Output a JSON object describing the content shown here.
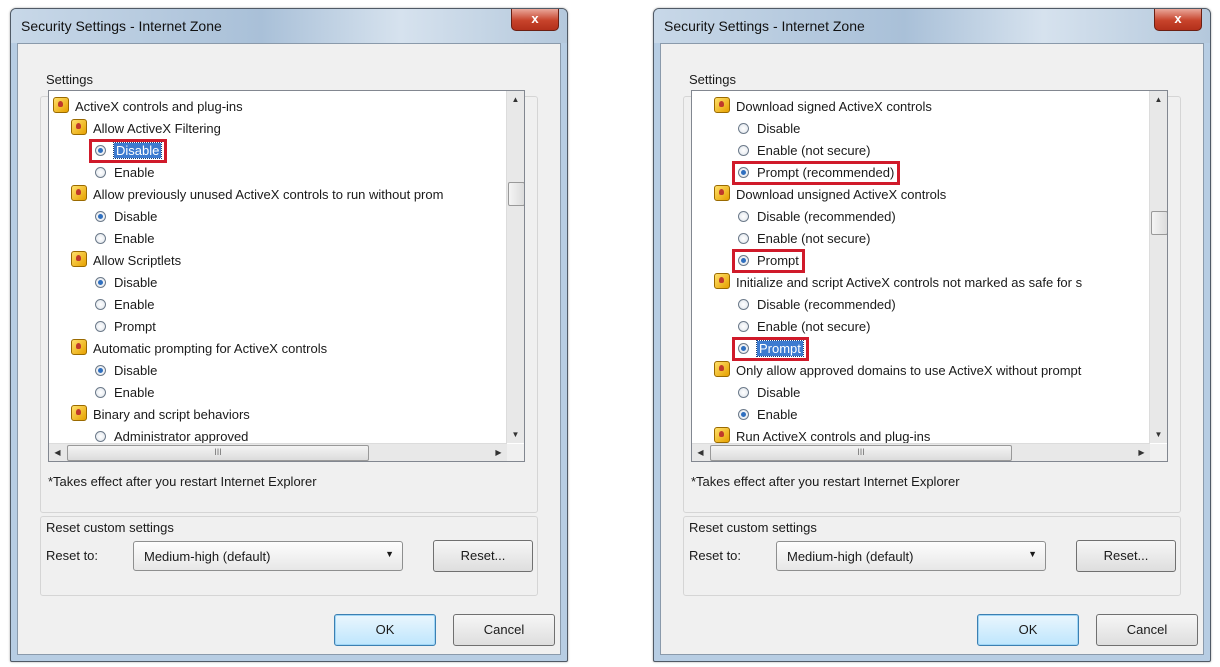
{
  "dialogs": [
    {
      "title": "Security Settings - Internet Zone",
      "close_label": "x",
      "settings_label": "Settings",
      "list_items": [
        {
          "kind": "category",
          "text": "ActiveX controls and plug-ins"
        },
        {
          "kind": "setting",
          "text": "Allow ActiveX Filtering"
        },
        {
          "kind": "option",
          "text": "Disable",
          "checked": true,
          "selected": true,
          "boxed": true
        },
        {
          "kind": "option",
          "text": "Enable",
          "checked": false
        },
        {
          "kind": "setting",
          "text": "Allow previously unused ActiveX controls to run without prom"
        },
        {
          "kind": "option",
          "text": "Disable",
          "checked": true
        },
        {
          "kind": "option",
          "text": "Enable",
          "checked": false
        },
        {
          "kind": "setting",
          "text": "Allow Scriptlets"
        },
        {
          "kind": "option",
          "text": "Disable",
          "checked": true
        },
        {
          "kind": "option",
          "text": "Enable",
          "checked": false
        },
        {
          "kind": "option",
          "text": "Prompt",
          "checked": false
        },
        {
          "kind": "setting",
          "text": "Automatic prompting for ActiveX controls"
        },
        {
          "kind": "option",
          "text": "Disable",
          "checked": true
        },
        {
          "kind": "option",
          "text": "Enable",
          "checked": false
        },
        {
          "kind": "setting",
          "text": "Binary and script behaviors"
        },
        {
          "kind": "option",
          "text": "Administrator approved",
          "checked": false
        }
      ],
      "vscroll_position": 0.25,
      "footnote": "*Takes effect after you restart Internet Explorer",
      "reset_group_label": "Reset custom settings",
      "reset_to_label": "Reset to:",
      "reset_to_value": "Medium-high (default)",
      "reset_button": "Reset...",
      "ok_button": "OK",
      "cancel_button": "Cancel"
    },
    {
      "title": "Security Settings - Internet Zone",
      "close_label": "x",
      "settings_label": "Settings",
      "list_items": [
        {
          "kind": "setting",
          "text": "Download signed ActiveX controls"
        },
        {
          "kind": "option",
          "text": "Disable",
          "checked": false
        },
        {
          "kind": "option",
          "text": "Enable (not secure)",
          "checked": false
        },
        {
          "kind": "option",
          "text": "Prompt (recommended)",
          "checked": true,
          "boxed": true
        },
        {
          "kind": "setting",
          "text": "Download unsigned ActiveX controls"
        },
        {
          "kind": "option",
          "text": "Disable (recommended)",
          "checked": false
        },
        {
          "kind": "option",
          "text": "Enable (not secure)",
          "checked": false
        },
        {
          "kind": "option",
          "text": "Prompt",
          "checked": true,
          "boxed": true
        },
        {
          "kind": "setting",
          "text": "Initialize and script ActiveX controls not marked as safe for s"
        },
        {
          "kind": "option",
          "text": "Disable (recommended)",
          "checked": false
        },
        {
          "kind": "option",
          "text": "Enable (not secure)",
          "checked": false
        },
        {
          "kind": "option",
          "text": "Prompt",
          "checked": true,
          "selected": true,
          "boxed": true
        },
        {
          "kind": "setting",
          "text": "Only allow approved domains to use ActiveX without prompt"
        },
        {
          "kind": "option",
          "text": "Disable",
          "checked": false
        },
        {
          "kind": "option",
          "text": "Enable",
          "checked": true
        },
        {
          "kind": "setting",
          "text": "Run ActiveX controls and plug-ins"
        }
      ],
      "vscroll_position": 0.35,
      "footnote": "*Takes effect after you restart Internet Explorer",
      "reset_group_label": "Reset custom settings",
      "reset_to_label": "Reset to:",
      "reset_to_value": "Medium-high (default)",
      "reset_button": "Reset...",
      "ok_button": "OK",
      "cancel_button": "Cancel"
    }
  ],
  "hscroll_thumb_label": "III",
  "colors": {
    "highlight_box": "#d01a2a",
    "selection": "#3d7bd0",
    "radio_dot": "#2f6fbf"
  }
}
